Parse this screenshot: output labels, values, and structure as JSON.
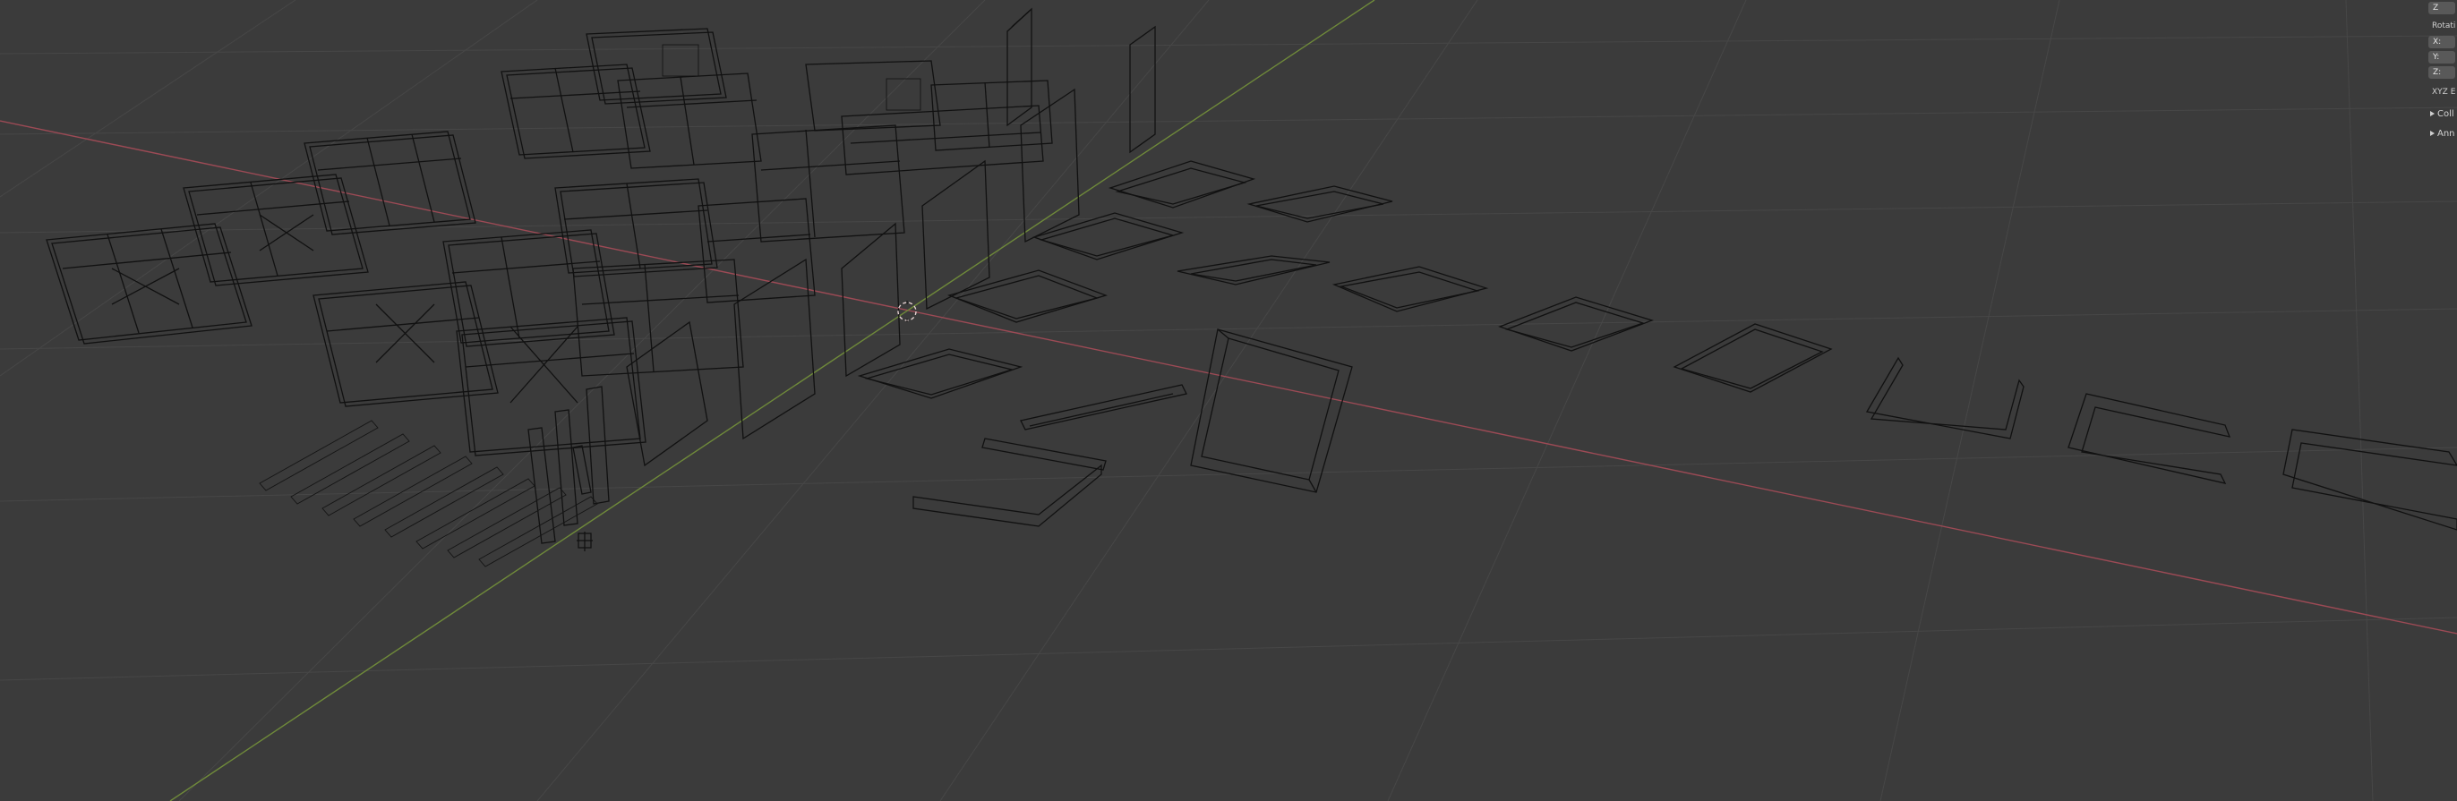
{
  "viewport": {
    "name": "3D Viewport",
    "shading": "Wireframe",
    "colors": {
      "background": "#3b3b3b",
      "grid": "#454545",
      "x_axis": "#9c4a55",
      "y_axis": "#6f8a3a",
      "wire": "#111111",
      "cursor": "#e0c8c8"
    }
  },
  "sidebar": {
    "partial_value": "Z",
    "rotation_label": "Rotati",
    "rotation_fields": [
      "X:",
      "Y:",
      "Z:"
    ],
    "rotation_mode": "XYZ E",
    "subpanels": [
      "Coll",
      "Ann"
    ]
  }
}
